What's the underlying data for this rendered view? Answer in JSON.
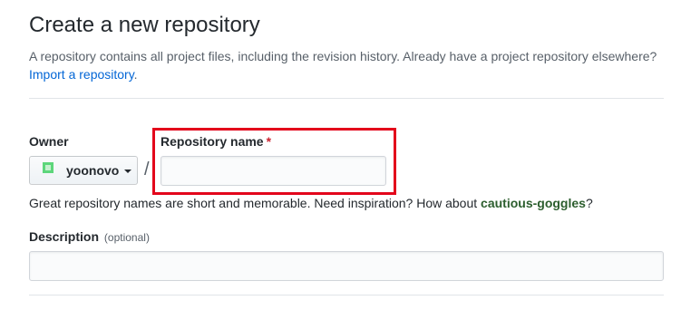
{
  "header": {
    "title": "Create a new repository",
    "subtitle": "A repository contains all project files, including the revision history. Already have a project repository elsewhere?",
    "import_link": "Import a repository",
    "import_suffix": "."
  },
  "owner": {
    "label": "Owner",
    "name": "yoonovo",
    "avatar_color": "#5dd67b"
  },
  "separator": "/",
  "repository_name": {
    "label": "Repository name",
    "required_marker": "*",
    "value": "",
    "highlight_color": "#e3051b"
  },
  "hint": {
    "text": "Great repository names are short and memorable. Need inspiration? How about ",
    "suggestion": "cautious-goggles",
    "suffix": "?"
  },
  "description": {
    "label": "Description",
    "optional": "(optional)",
    "value": ""
  }
}
